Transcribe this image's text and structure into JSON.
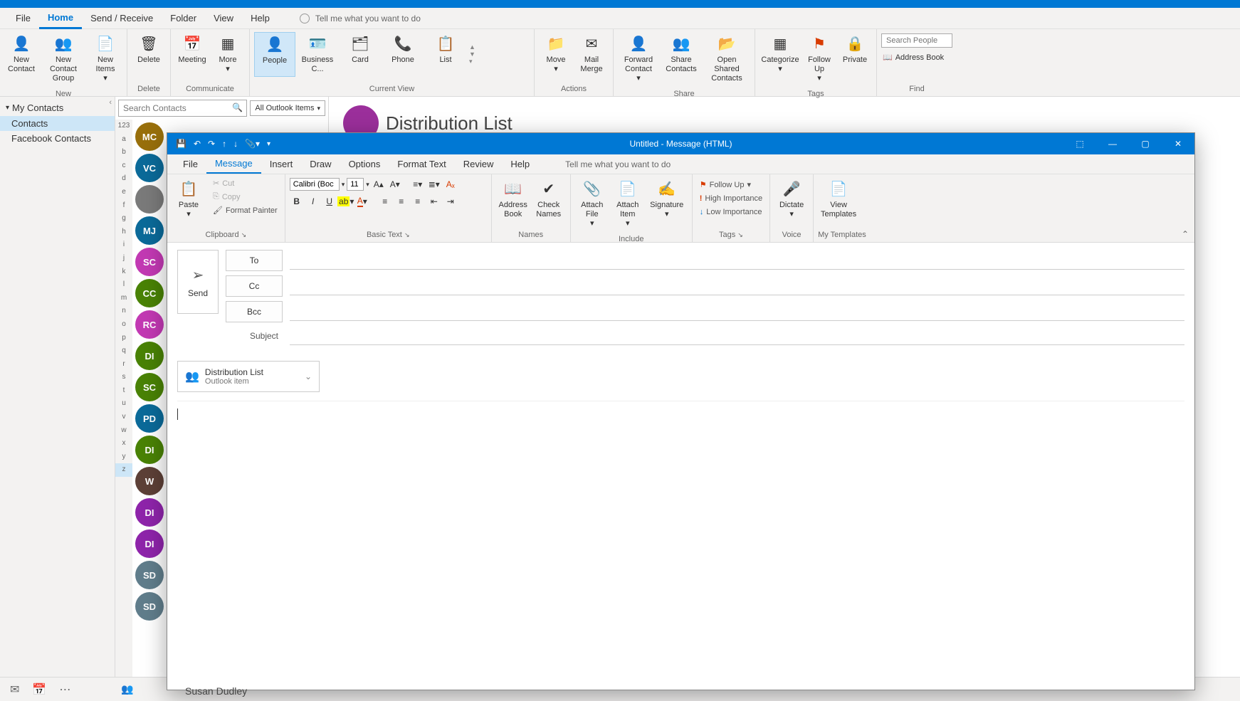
{
  "main_menu": {
    "tabs": [
      "File",
      "Home",
      "Send / Receive",
      "Folder",
      "View",
      "Help"
    ],
    "active": "Home",
    "tell_me": "Tell me what you want to do"
  },
  "ribbon": {
    "new": {
      "label": "New",
      "new_contact": "New Contact",
      "new_group": "New Contact Group",
      "new_items": "New Items"
    },
    "delete": {
      "label": "Delete",
      "delete": "Delete"
    },
    "communicate": {
      "label": "Communicate",
      "meeting": "Meeting",
      "more": "More"
    },
    "current_view": {
      "label": "Current View",
      "people": "People",
      "business": "Business C...",
      "card": "Card",
      "phone": "Phone",
      "list": "List"
    },
    "actions": {
      "label": "Actions",
      "move": "Move",
      "mail_merge": "Mail Merge"
    },
    "share": {
      "label": "Share",
      "forward": "Forward Contact",
      "share_contacts": "Share Contacts",
      "open_shared": "Open Shared Contacts"
    },
    "tags": {
      "label": "Tags",
      "categorize": "Categorize",
      "follow_up": "Follow Up",
      "private": "Private"
    },
    "find": {
      "label": "Find",
      "search_ph": "Search People",
      "address_book": "Address Book"
    }
  },
  "nav": {
    "header": "My Contacts",
    "items": [
      "Contacts",
      "Facebook Contacts"
    ],
    "selected": "Contacts"
  },
  "search": {
    "placeholder": "Search Contacts",
    "filter": "All Outlook Items"
  },
  "letters": [
    "123",
    "a",
    "b",
    "c",
    "d",
    "e",
    "f",
    "g",
    "h",
    "i",
    "j",
    "k",
    "l",
    "m",
    "n",
    "o",
    "p",
    "q",
    "r",
    "s",
    "t",
    "u",
    "v",
    "w",
    "x",
    "y",
    "z"
  ],
  "contacts": [
    {
      "initials": "MC",
      "color": "#986f0b"
    },
    {
      "initials": "VC",
      "color": "#0b6a99"
    },
    {
      "initials": "",
      "color": "#7a7a7a",
      "photo": true
    },
    {
      "initials": "MJ",
      "color": "#0b6a99"
    },
    {
      "initials": "SC",
      "color": "#c239b3"
    },
    {
      "initials": "CC",
      "color": "#498205"
    },
    {
      "initials": "RC",
      "color": "#c239b3"
    },
    {
      "initials": "DI",
      "color": "#498205"
    },
    {
      "initials": "SC",
      "color": "#498205"
    },
    {
      "initials": "PD",
      "color": "#0b6a99"
    },
    {
      "initials": "DI",
      "color": "#498205"
    },
    {
      "initials": "W",
      "color": "#5d4037"
    },
    {
      "initials": "DI",
      "color": "#8e24aa"
    },
    {
      "initials": "DI",
      "color": "#8e24aa"
    },
    {
      "initials": "SD",
      "color": "#607d8b"
    },
    {
      "initials": "SD",
      "color": "#607d8b"
    }
  ],
  "reading": {
    "title": "Distribution List",
    "visible_name": "Susan Dudley"
  },
  "msg": {
    "title": "Untitled  -  Message (HTML)",
    "menu": {
      "tabs": [
        "File",
        "Message",
        "Insert",
        "Draw",
        "Options",
        "Format Text",
        "Review",
        "Help"
      ],
      "active": "Message",
      "tell_me": "Tell me what you want to do"
    },
    "clipboard": {
      "label": "Clipboard",
      "paste": "Paste",
      "cut": "Cut",
      "copy": "Copy",
      "format_painter": "Format Painter"
    },
    "basic_text": {
      "label": "Basic Text",
      "font": "Calibri (Boc",
      "size": "11"
    },
    "names": {
      "label": "Names",
      "address_book": "Address Book",
      "check_names": "Check Names"
    },
    "include": {
      "label": "Include",
      "attach_file": "Attach File",
      "attach_item": "Attach Item",
      "signature": "Signature"
    },
    "tags": {
      "label": "Tags",
      "follow_up": "Follow Up",
      "high": "High Importance",
      "low": "Low Importance"
    },
    "voice": {
      "label": "Voice",
      "dictate": "Dictate"
    },
    "templates": {
      "label": "My Templates",
      "view": "View Templates"
    },
    "compose": {
      "send": "Send",
      "to": "To",
      "cc": "Cc",
      "bcc": "Bcc",
      "subject": "Subject"
    },
    "attachment": {
      "name": "Distribution List",
      "type": "Outlook item"
    }
  }
}
